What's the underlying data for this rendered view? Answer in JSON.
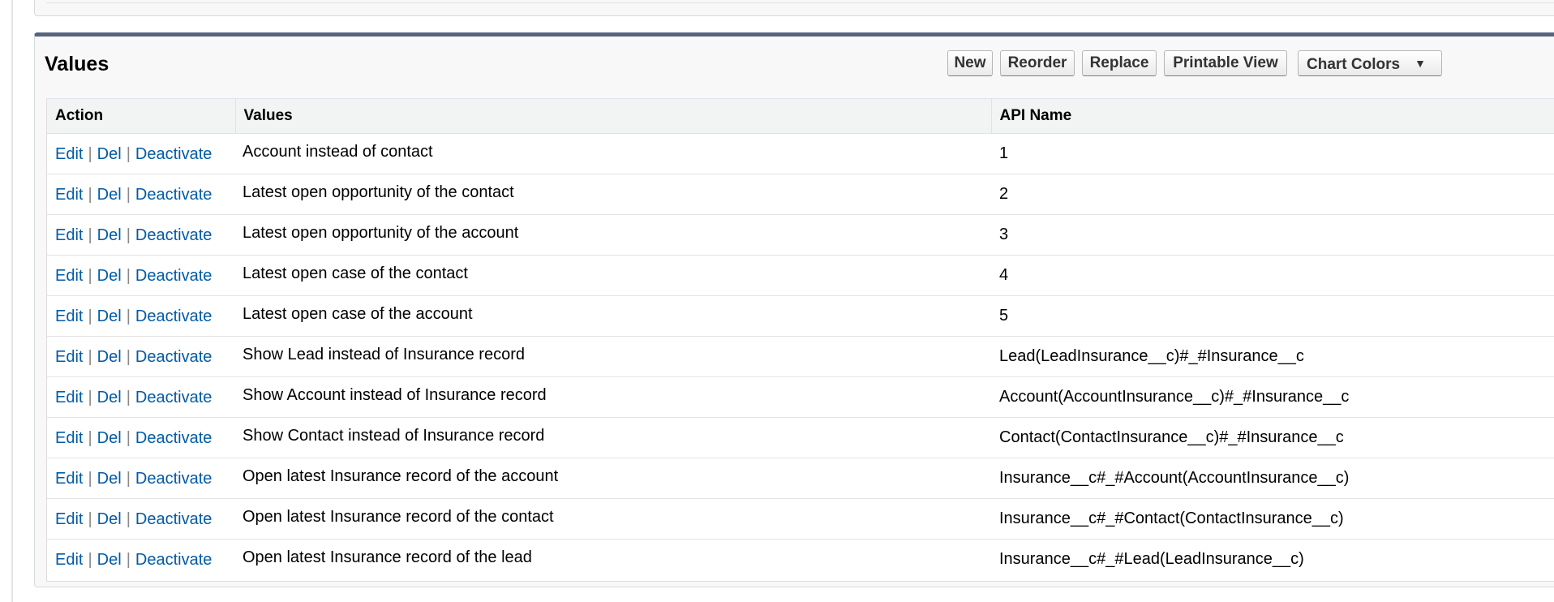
{
  "panel": {
    "title": "Values",
    "buttons": {
      "new": "New",
      "reorder": "Reorder",
      "replace": "Replace",
      "printable_view": "Printable View",
      "chart_colors": "Chart Colors"
    }
  },
  "table": {
    "headers": {
      "action": "Action",
      "values": "Values",
      "api_name": "API Name"
    },
    "action_labels": {
      "edit": "Edit",
      "del": "Del",
      "deactivate": "Deactivate",
      "separator": "|"
    },
    "rows": [
      {
        "value": "Account instead of contact",
        "api_name": "1"
      },
      {
        "value": "Latest open opportunity of the contact",
        "api_name": "2"
      },
      {
        "value": "Latest open opportunity of the account",
        "api_name": "3"
      },
      {
        "value": "Latest open case of the contact",
        "api_name": "4"
      },
      {
        "value": "Latest open case of the account",
        "api_name": "5"
      },
      {
        "value": "Show Lead instead of Insurance record",
        "api_name": "Lead(LeadInsurance__c)#_#Insurance__c"
      },
      {
        "value": "Show Account instead of Insurance record",
        "api_name": "Account(AccountInsurance__c)#_#Insurance__c"
      },
      {
        "value": "Show Contact instead of Insurance record",
        "api_name": "Contact(ContactInsurance__c)#_#Insurance__c"
      },
      {
        "value": "Open latest Insurance record of the account",
        "api_name": "Insurance__c#_#Account(AccountInsurance__c)"
      },
      {
        "value": "Open latest Insurance record of the contact",
        "api_name": "Insurance__c#_#Contact(ContactInsurance__c)"
      },
      {
        "value": "Open latest Insurance record of the lead",
        "api_name": "Insurance__c#_#Lead(LeadInsurance__c)"
      }
    ]
  },
  "colors": {
    "link": "#015ba7",
    "panel_top_border": "#56657d",
    "header_bg": "#f2f3f3"
  }
}
